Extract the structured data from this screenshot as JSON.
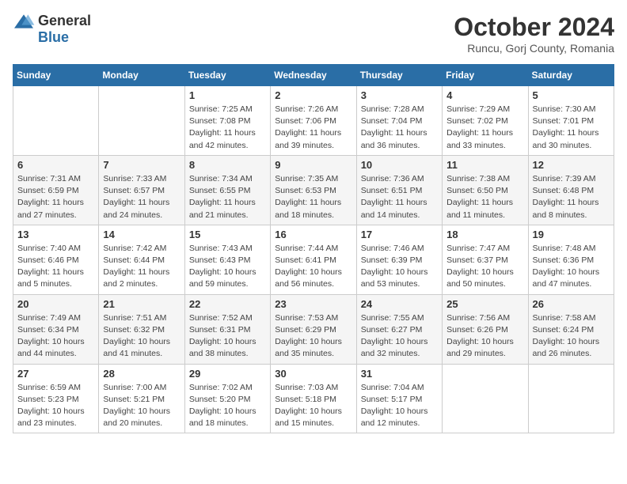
{
  "logo": {
    "general": "General",
    "blue": "Blue"
  },
  "header": {
    "month": "October 2024",
    "location": "Runcu, Gorj County, Romania"
  },
  "weekdays": [
    "Sunday",
    "Monday",
    "Tuesday",
    "Wednesday",
    "Thursday",
    "Friday",
    "Saturday"
  ],
  "weeks": [
    [
      {
        "day": "",
        "info": ""
      },
      {
        "day": "",
        "info": ""
      },
      {
        "day": "1",
        "info": "Sunrise: 7:25 AM\nSunset: 7:08 PM\nDaylight: 11 hours and 42 minutes."
      },
      {
        "day": "2",
        "info": "Sunrise: 7:26 AM\nSunset: 7:06 PM\nDaylight: 11 hours and 39 minutes."
      },
      {
        "day": "3",
        "info": "Sunrise: 7:28 AM\nSunset: 7:04 PM\nDaylight: 11 hours and 36 minutes."
      },
      {
        "day": "4",
        "info": "Sunrise: 7:29 AM\nSunset: 7:02 PM\nDaylight: 11 hours and 33 minutes."
      },
      {
        "day": "5",
        "info": "Sunrise: 7:30 AM\nSunset: 7:01 PM\nDaylight: 11 hours and 30 minutes."
      }
    ],
    [
      {
        "day": "6",
        "info": "Sunrise: 7:31 AM\nSunset: 6:59 PM\nDaylight: 11 hours and 27 minutes."
      },
      {
        "day": "7",
        "info": "Sunrise: 7:33 AM\nSunset: 6:57 PM\nDaylight: 11 hours and 24 minutes."
      },
      {
        "day": "8",
        "info": "Sunrise: 7:34 AM\nSunset: 6:55 PM\nDaylight: 11 hours and 21 minutes."
      },
      {
        "day": "9",
        "info": "Sunrise: 7:35 AM\nSunset: 6:53 PM\nDaylight: 11 hours and 18 minutes."
      },
      {
        "day": "10",
        "info": "Sunrise: 7:36 AM\nSunset: 6:51 PM\nDaylight: 11 hours and 14 minutes."
      },
      {
        "day": "11",
        "info": "Sunrise: 7:38 AM\nSunset: 6:50 PM\nDaylight: 11 hours and 11 minutes."
      },
      {
        "day": "12",
        "info": "Sunrise: 7:39 AM\nSunset: 6:48 PM\nDaylight: 11 hours and 8 minutes."
      }
    ],
    [
      {
        "day": "13",
        "info": "Sunrise: 7:40 AM\nSunset: 6:46 PM\nDaylight: 11 hours and 5 minutes."
      },
      {
        "day": "14",
        "info": "Sunrise: 7:42 AM\nSunset: 6:44 PM\nDaylight: 11 hours and 2 minutes."
      },
      {
        "day": "15",
        "info": "Sunrise: 7:43 AM\nSunset: 6:43 PM\nDaylight: 10 hours and 59 minutes."
      },
      {
        "day": "16",
        "info": "Sunrise: 7:44 AM\nSunset: 6:41 PM\nDaylight: 10 hours and 56 minutes."
      },
      {
        "day": "17",
        "info": "Sunrise: 7:46 AM\nSunset: 6:39 PM\nDaylight: 10 hours and 53 minutes."
      },
      {
        "day": "18",
        "info": "Sunrise: 7:47 AM\nSunset: 6:37 PM\nDaylight: 10 hours and 50 minutes."
      },
      {
        "day": "19",
        "info": "Sunrise: 7:48 AM\nSunset: 6:36 PM\nDaylight: 10 hours and 47 minutes."
      }
    ],
    [
      {
        "day": "20",
        "info": "Sunrise: 7:49 AM\nSunset: 6:34 PM\nDaylight: 10 hours and 44 minutes."
      },
      {
        "day": "21",
        "info": "Sunrise: 7:51 AM\nSunset: 6:32 PM\nDaylight: 10 hours and 41 minutes."
      },
      {
        "day": "22",
        "info": "Sunrise: 7:52 AM\nSunset: 6:31 PM\nDaylight: 10 hours and 38 minutes."
      },
      {
        "day": "23",
        "info": "Sunrise: 7:53 AM\nSunset: 6:29 PM\nDaylight: 10 hours and 35 minutes."
      },
      {
        "day": "24",
        "info": "Sunrise: 7:55 AM\nSunset: 6:27 PM\nDaylight: 10 hours and 32 minutes."
      },
      {
        "day": "25",
        "info": "Sunrise: 7:56 AM\nSunset: 6:26 PM\nDaylight: 10 hours and 29 minutes."
      },
      {
        "day": "26",
        "info": "Sunrise: 7:58 AM\nSunset: 6:24 PM\nDaylight: 10 hours and 26 minutes."
      }
    ],
    [
      {
        "day": "27",
        "info": "Sunrise: 6:59 AM\nSunset: 5:23 PM\nDaylight: 10 hours and 23 minutes."
      },
      {
        "day": "28",
        "info": "Sunrise: 7:00 AM\nSunset: 5:21 PM\nDaylight: 10 hours and 20 minutes."
      },
      {
        "day": "29",
        "info": "Sunrise: 7:02 AM\nSunset: 5:20 PM\nDaylight: 10 hours and 18 minutes."
      },
      {
        "day": "30",
        "info": "Sunrise: 7:03 AM\nSunset: 5:18 PM\nDaylight: 10 hours and 15 minutes."
      },
      {
        "day": "31",
        "info": "Sunrise: 7:04 AM\nSunset: 5:17 PM\nDaylight: 10 hours and 12 minutes."
      },
      {
        "day": "",
        "info": ""
      },
      {
        "day": "",
        "info": ""
      }
    ]
  ]
}
